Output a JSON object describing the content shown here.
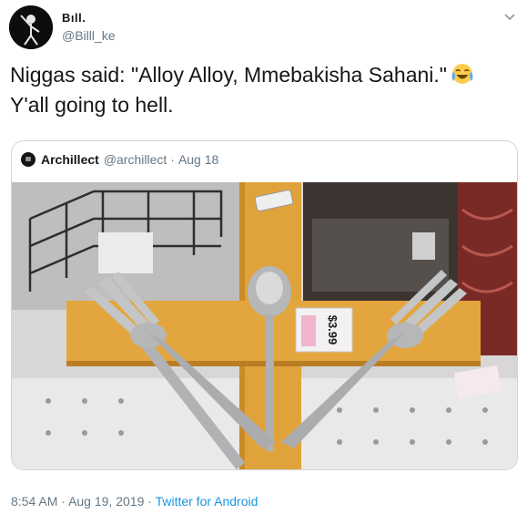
{
  "user": {
    "display_name": "Bıll.",
    "handle": "@Billl_ke"
  },
  "tweet": {
    "text": "Niggas said: \"Alloy Alloy, Mmebakisha Sahani.\"",
    "text_line2": "Y'all going to hell."
  },
  "quote": {
    "avatar_initials": "III",
    "name": "Archillect",
    "handle": "@archillect",
    "separator": "·",
    "date": "Aug 18",
    "price_tag": "$3.99"
  },
  "meta": {
    "time": "8:54 AM",
    "separator1": "·",
    "date": "Aug 19, 2019",
    "separator2": "·",
    "source": "Twitter for Android"
  },
  "icons": {
    "emoji": "face-with-tears-of-joy-icon",
    "chevron": "chevron-down-icon"
  },
  "colors": {
    "link": "#1b95e0",
    "secondary_text": "#657786",
    "border": "#ccd6dd",
    "wood": "#e0a33b"
  }
}
